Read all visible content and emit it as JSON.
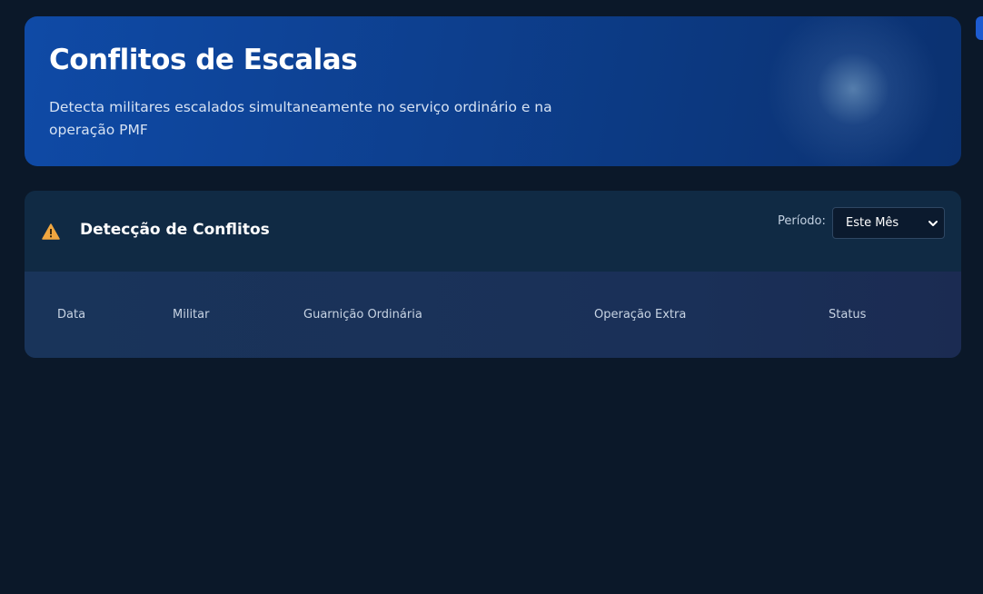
{
  "header": {
    "title": "Conflitos de Escalas",
    "subtitle": "Detecta militares escalados simultaneamente no serviço ordinário e na operação PMF"
  },
  "panel": {
    "title": "Detecção de Conflitos",
    "icon": "warning-icon",
    "period_label": "Período:",
    "period_value": "Este Mês",
    "columns": [
      "Data",
      "Militar",
      "Guarnição Ordinária",
      "Operação Extra",
      "Status"
    ],
    "rows": []
  },
  "colors": {
    "background": "#0b1829",
    "hero_start": "#0f4aa6",
    "hero_end": "#0b3170",
    "panel": "#102a44",
    "table_header": "#19345a",
    "warning": "#f0a640"
  }
}
